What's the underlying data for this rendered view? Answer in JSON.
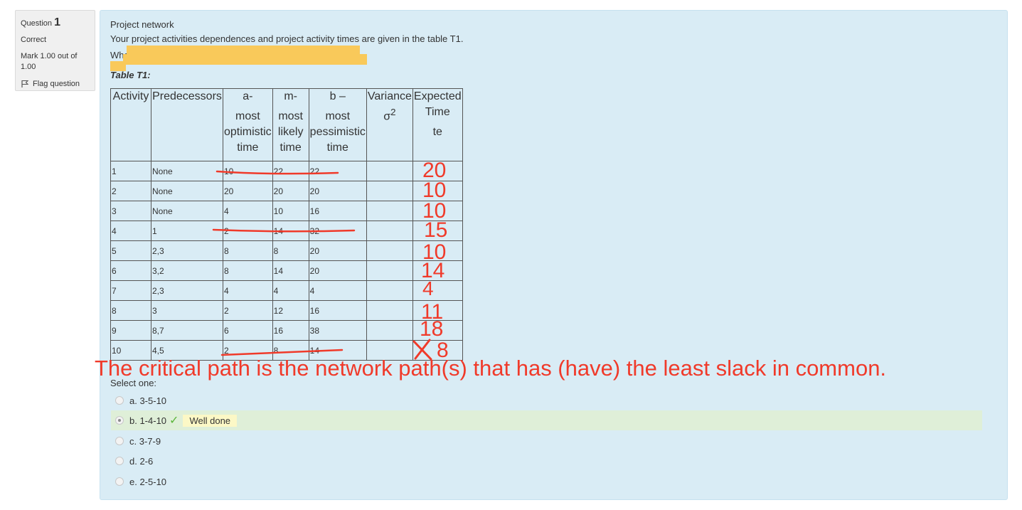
{
  "info": {
    "question_label": "Question",
    "question_number": "1",
    "state": "Correct",
    "mark": "Mark 1.00 out of 1.00",
    "flag_label": "Flag question"
  },
  "question": {
    "title": "Project network",
    "text": "Your project activities dependences and project activity times are given in the table T1.",
    "partial_text": "What",
    "table_caption": "Table T1:"
  },
  "table": {
    "headers": [
      "Activity",
      "Predecessors",
      "a-\nmost optimistic time",
      "m-\nmost likely time",
      "b –\nmost pessimistic time",
      "Variance σ2",
      "Expected Time\nte"
    ],
    "header_parts": {
      "activity": "Activity",
      "predecessors": "Predecessors",
      "a_top": "a-",
      "a_bottom": "most optimistic time",
      "m_top": "m-",
      "m_bottom": "most likely time",
      "b_top": "b –",
      "b_bottom": "most pessimistic time",
      "var_top": "Variance",
      "var_sym": "σ",
      "var_sup": "2",
      "exp_top": "Expected Time",
      "exp_bottom": "te"
    },
    "rows": [
      {
        "activity": "1",
        "pred": "None",
        "a": "10",
        "m": "22",
        "b": "22"
      },
      {
        "activity": "2",
        "pred": "None",
        "a": "20",
        "m": "20",
        "b": "20"
      },
      {
        "activity": "3",
        "pred": "None",
        "a": "4",
        "m": "10",
        "b": "16"
      },
      {
        "activity": "4",
        "pred": "1",
        "a": "2",
        "m": "14",
        "b": "32"
      },
      {
        "activity": "5",
        "pred": "2,3",
        "a": "8",
        "m": "8",
        "b": "20"
      },
      {
        "activity": "6",
        "pred": "3,2",
        "a": "8",
        "m": "14",
        "b": "20"
      },
      {
        "activity": "7",
        "pred": "2,3",
        "a": "4",
        "m": "4",
        "b": "4"
      },
      {
        "activity": "8",
        "pred": "3",
        "a": "2",
        "m": "12",
        "b": "16"
      },
      {
        "activity": "9",
        "pred": "8,7",
        "a": "6",
        "m": "16",
        "b": "38"
      },
      {
        "activity": "10",
        "pred": "4,5",
        "a": "2",
        "m": "8",
        "b": "14"
      }
    ]
  },
  "handwritten": {
    "expected": [
      "20",
      "10",
      "10",
      "15",
      "10",
      "14",
      "4",
      "11",
      "18",
      "8"
    ],
    "annotation": "The critical path is the network path(s) that has (have) the least slack in common.",
    "color": "#f03a2a"
  },
  "answer": {
    "prompt": "Select one:",
    "options": [
      "a. 3-5-10",
      "b. 1-4-10",
      "c. 3-7-9",
      "d. 2-6",
      "e. 2-5-10"
    ],
    "selected_index": 1,
    "feedback": "Well done"
  },
  "colors": {
    "content_bg": "#d9ecf5",
    "info_bg": "#f0f0f0",
    "correct_bg": "#dfefd8",
    "feedback_bg": "#fcf8c6",
    "check": "#5bb53a"
  }
}
